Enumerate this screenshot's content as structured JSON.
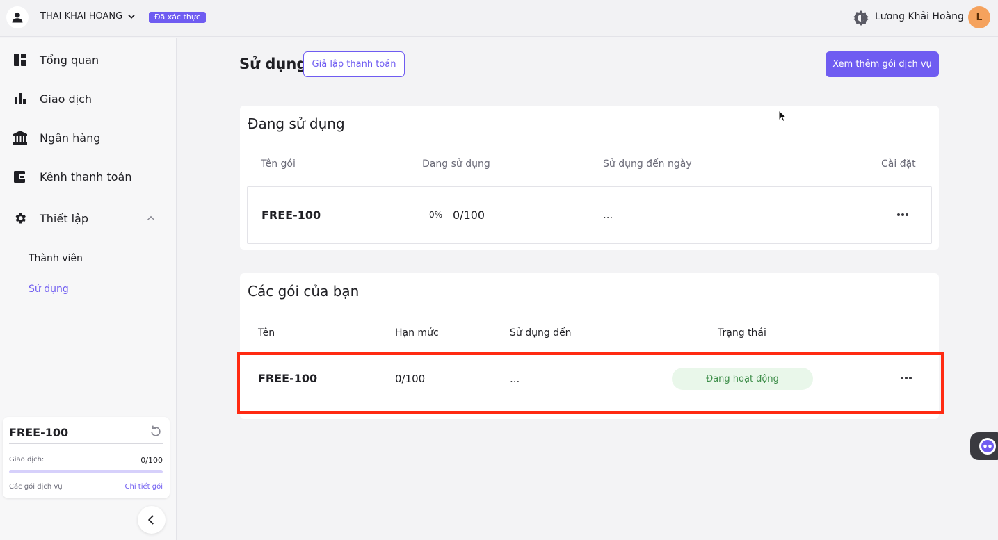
{
  "topbar": {
    "org_name": "THAI KHAI HOANG",
    "verified_badge": "Đã xác thực",
    "user_name": "Lương Khải Hoàng",
    "avatar_letter": "L"
  },
  "sidebar": {
    "items": [
      {
        "label": "Tổng quan",
        "icon": "dashboard-icon"
      },
      {
        "label": "Giao dịch",
        "icon": "bar-chart-icon"
      },
      {
        "label": "Ngân hàng",
        "icon": "bank-icon"
      },
      {
        "label": "Kênh thanh toán",
        "icon": "wallet-icon"
      },
      {
        "label": "Thiết lập",
        "icon": "gear-icon"
      }
    ],
    "sub_items": [
      {
        "label": "Thành viên"
      },
      {
        "label": "Sử dụng",
        "active": true
      }
    ],
    "plan_card": {
      "name": "FREE-100",
      "transactions_label": "Giao dịch:",
      "transactions_value": "0/100",
      "usage_fraction": 0.0,
      "services_label": "Các gói dịch vụ",
      "detail_link": "Chi tiết gói"
    }
  },
  "main": {
    "title": "Sử dụng",
    "simulate_button": "Giả lập thanh toán",
    "more_plans_button": "Xem thêm gói dịch vụ",
    "in_use": {
      "title": "Đang sử dụng",
      "headers": [
        "Tên gói",
        "Đang sử dụng",
        "Sử dụng đến ngày",
        "Cài đặt"
      ],
      "row": {
        "name": "FREE-100",
        "percent": "0%",
        "usage": "0/100",
        "until": "..."
      }
    },
    "your_plans": {
      "title": "Các gói của bạn",
      "headers": [
        "Tên",
        "Hạn mức",
        "Sử dụng đến",
        "Trạng thái"
      ],
      "row": {
        "name": "FREE-100",
        "limit": "0/100",
        "until": "...",
        "status": "Đang hoạt động"
      }
    }
  },
  "colors": {
    "accent": "#6f5cf1",
    "highlight": "#ff2a12",
    "status_bg": "#e9f7ea",
    "status_text": "#3e8e4a"
  }
}
